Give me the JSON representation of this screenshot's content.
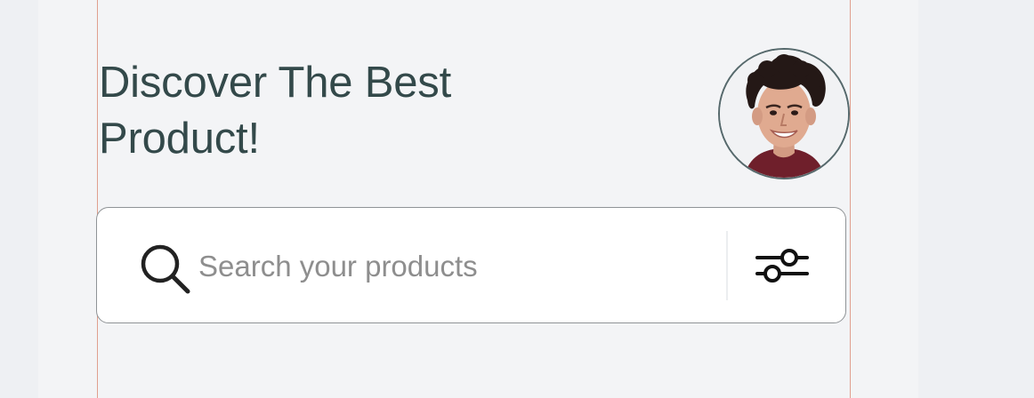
{
  "header": {
    "title_line1": "Discover The Best",
    "title_line2": "Product!"
  },
  "profile": {
    "avatar_icon": "user-avatar-photo"
  },
  "search": {
    "placeholder": "Search your products",
    "value": "",
    "search_icon": "search-icon",
    "filter_icon": "sliders-icon"
  },
  "colors": {
    "title": "#33494a",
    "panel_background": "#f3f4f6",
    "search_background": "#ffffff",
    "guide_line": "#e0a08f"
  }
}
